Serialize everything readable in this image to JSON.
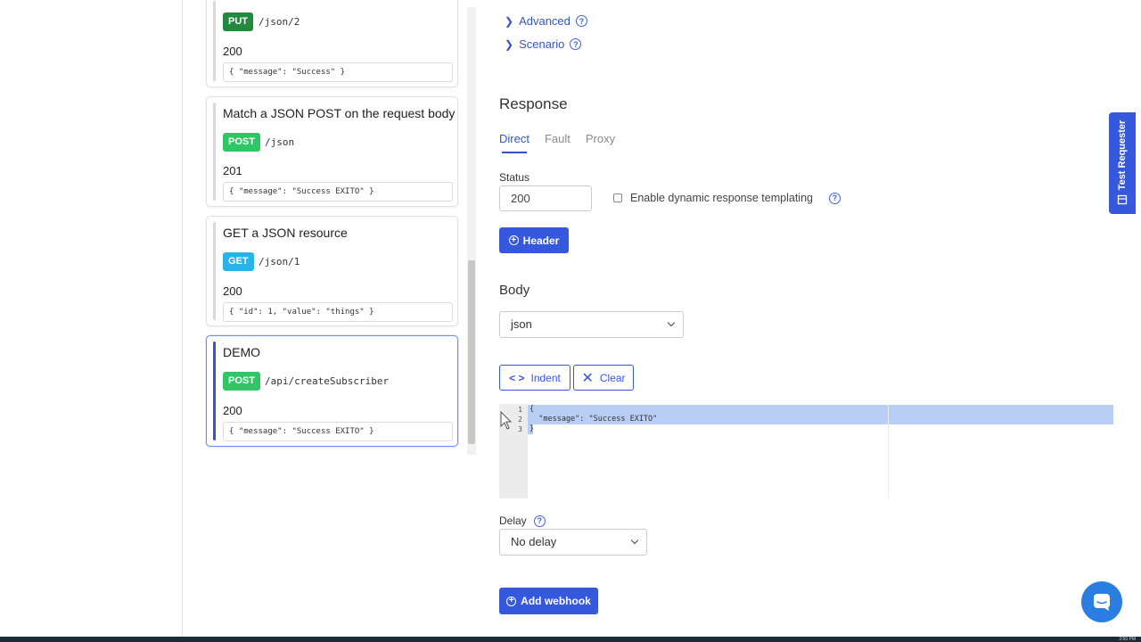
{
  "cards": [
    {
      "title": "",
      "method": "PUT",
      "path": "/json/2",
      "status": "200",
      "body": "{ \"message\": \"Success\" }"
    },
    {
      "title": "Match a JSON POST on the request body",
      "method": "POST",
      "path": "/json",
      "status": "201",
      "body": "{ \"message\": \"Success EXITO\" }"
    },
    {
      "title": "GET a JSON resource",
      "method": "GET",
      "path": "/json/1",
      "status": "200",
      "body": "{ \"id\": 1, \"value\": \"things\" }"
    },
    {
      "title": "DEMO",
      "method": "POST",
      "path": "/api/createSubscriber",
      "status": "200",
      "body": "{ \"message\": \"Success EXITO\" }"
    }
  ],
  "links": {
    "advanced": "Advanced",
    "scenario": "Scenario",
    "help": "?"
  },
  "response": {
    "title": "Response",
    "tabs": [
      "Direct",
      "Fault",
      "Proxy"
    ],
    "status_label": "Status",
    "status_value": "200",
    "templating_label": "Enable dynamic response templating",
    "header_button": "Header",
    "body_title": "Body",
    "body_format": "json",
    "indent_button": "Indent",
    "clear_button": "Clear",
    "editor_lines": [
      "1",
      "2",
      "3"
    ],
    "editor_code": [
      "{",
      "  \"message\": \"Success EXITO\"",
      "}"
    ],
    "delay_label": "Delay",
    "delay_value": "No delay",
    "webhook_button": "Add webhook"
  },
  "side_tab": "Test Requester",
  "clock": "2:50 PM",
  "colors": {
    "primary": "#3558dc",
    "put": "#238a3d",
    "post": "#2fc765",
    "get": "#2ab3e6",
    "chat": "#2a7de1"
  }
}
